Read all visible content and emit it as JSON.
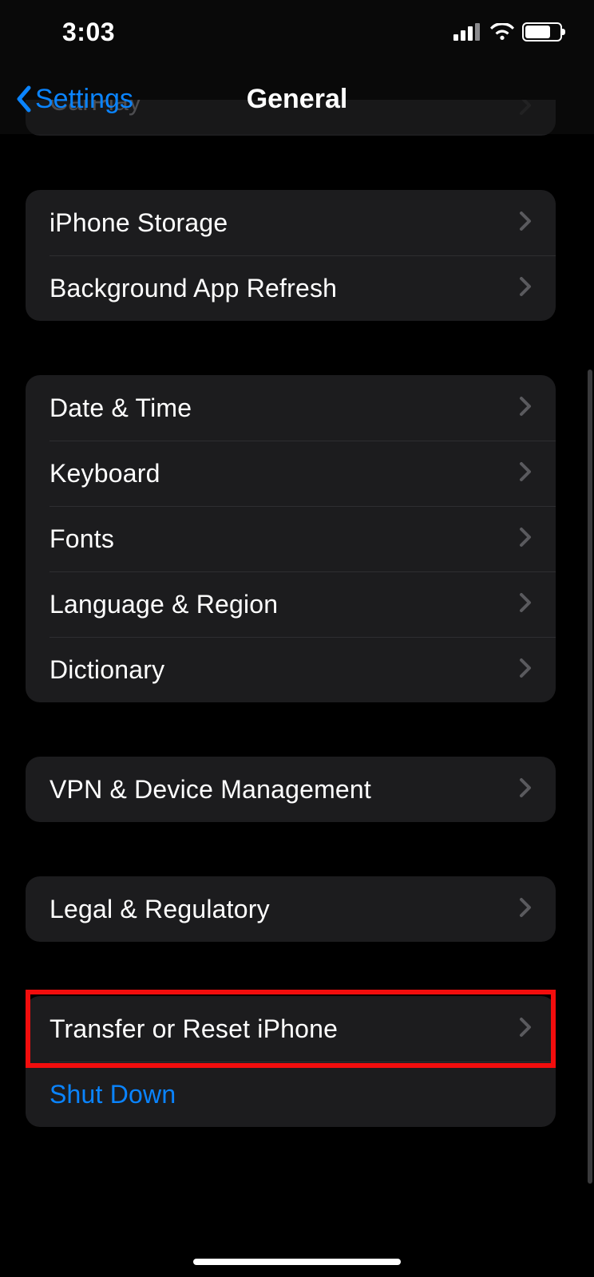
{
  "status": {
    "time": "3:03"
  },
  "nav": {
    "back_label": "Settings",
    "title": "General"
  },
  "groups": [
    {
      "type": "cutoff_first",
      "items": [
        {
          "id": "carplay",
          "label": "CarPlay"
        }
      ]
    },
    {
      "items": [
        {
          "id": "iphone-storage",
          "label": "iPhone Storage"
        },
        {
          "id": "background-app-refresh",
          "label": "Background App Refresh"
        }
      ]
    },
    {
      "items": [
        {
          "id": "date-time",
          "label": "Date & Time"
        },
        {
          "id": "keyboard",
          "label": "Keyboard"
        },
        {
          "id": "fonts",
          "label": "Fonts"
        },
        {
          "id": "language-region",
          "label": "Language & Region"
        },
        {
          "id": "dictionary",
          "label": "Dictionary"
        }
      ]
    },
    {
      "items": [
        {
          "id": "vpn-device-management",
          "label": "VPN & Device Management"
        }
      ]
    },
    {
      "items": [
        {
          "id": "legal-regulatory",
          "label": "Legal & Regulatory"
        }
      ]
    },
    {
      "items": [
        {
          "id": "transfer-reset",
          "label": "Transfer or Reset iPhone",
          "highlighted": true
        },
        {
          "id": "shut-down",
          "label": "Shut Down",
          "style": "link",
          "no_chevron": true
        }
      ]
    }
  ]
}
